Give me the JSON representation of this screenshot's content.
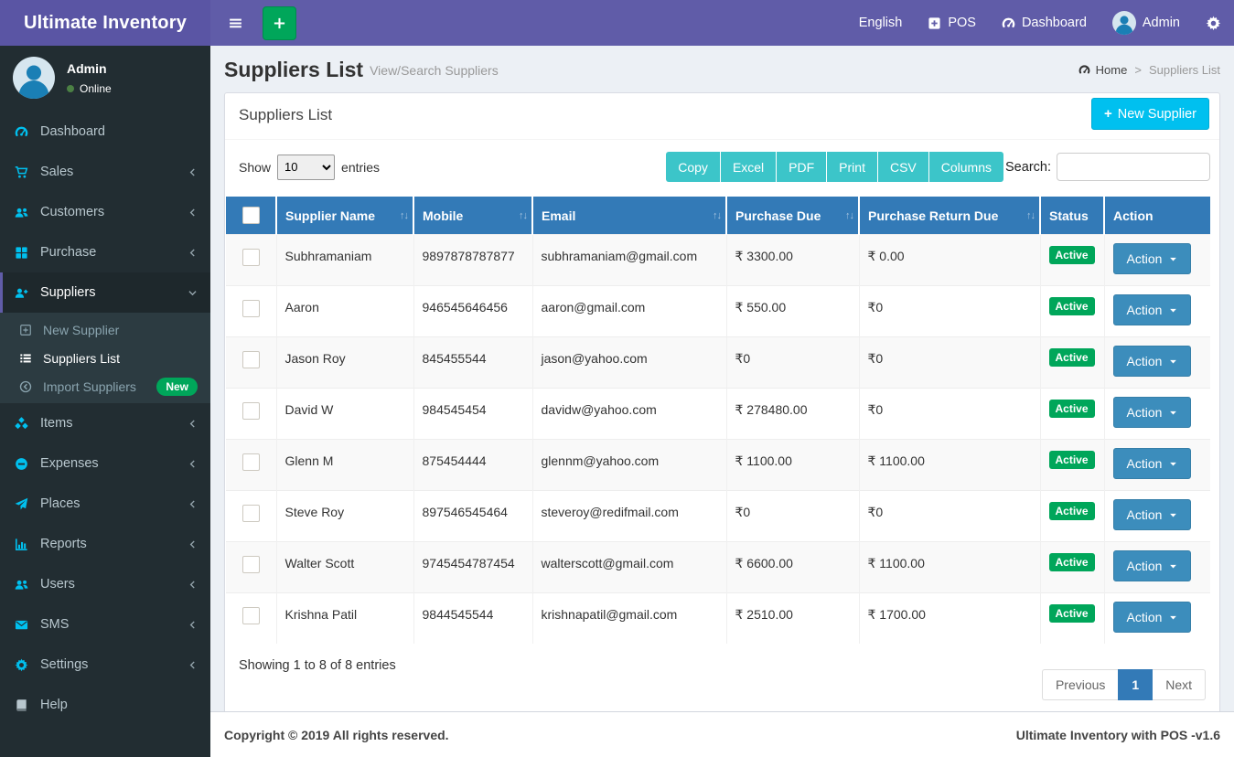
{
  "navbar": {
    "brand": "Ultimate Inventory",
    "language": "English",
    "pos": "POS",
    "dashboard": "Dashboard",
    "user": "Admin"
  },
  "sidebar": {
    "user": {
      "name": "Admin",
      "status": "Online"
    },
    "items": [
      {
        "label": "Dashboard",
        "icon": "tachometer-icon"
      },
      {
        "label": "Sales",
        "icon": "cart-icon",
        "chevron": "left"
      },
      {
        "label": "Customers",
        "icon": "users-icon",
        "chevron": "left"
      },
      {
        "label": "Purchase",
        "icon": "grid-icon",
        "chevron": "left"
      },
      {
        "label": "Suppliers",
        "icon": "user-plus-icon",
        "chevron": "down",
        "active": true,
        "submenu": [
          {
            "label": "New Supplier",
            "icon": "plus-square-outline-icon"
          },
          {
            "label": "Suppliers List",
            "icon": "list-icon",
            "active": true
          },
          {
            "label": "Import Suppliers",
            "icon": "arrow-circle-left-icon",
            "badge": "New"
          }
        ]
      },
      {
        "label": "Items",
        "icon": "cubes-icon",
        "chevron": "left"
      },
      {
        "label": "Expenses",
        "icon": "minus-circle-icon",
        "chevron": "left"
      },
      {
        "label": "Places",
        "icon": "paper-plane-icon",
        "chevron": "left"
      },
      {
        "label": "Reports",
        "icon": "bar-chart-icon",
        "chevron": "left"
      },
      {
        "label": "Users",
        "icon": "users-icon",
        "chevron": "left"
      },
      {
        "label": "SMS",
        "icon": "envelope-icon",
        "chevron": "left"
      },
      {
        "label": "Settings",
        "icon": "cogs-icon",
        "chevron": "left"
      },
      {
        "label": "Help",
        "icon": "book-icon"
      }
    ]
  },
  "page": {
    "title": "Suppliers List",
    "subtitle": "View/Search Suppliers",
    "breadcrumb": {
      "home": "Home",
      "current": "Suppliers List"
    }
  },
  "card": {
    "title": "Suppliers List",
    "new_button": "New Supplier",
    "show_label": "Show",
    "entries_label": "entries",
    "page_length": "10",
    "export_buttons": [
      "Copy",
      "Excel",
      "PDF",
      "Print",
      "CSV",
      "Columns"
    ],
    "search_label": "Search:",
    "search_value": "",
    "info": "Showing 1 to 8 of 8 entries",
    "pagination": {
      "previous": "Previous",
      "current": "1",
      "next": "Next"
    }
  },
  "table": {
    "columns": [
      "Supplier Name",
      "Mobile",
      "Email",
      "Purchase Due",
      "Purchase Return Due",
      "Status",
      "Action"
    ],
    "sortable": [
      true,
      true,
      true,
      true,
      true,
      false,
      false
    ],
    "action_label": "Action",
    "rows": [
      {
        "name": "Subhramaniam",
        "mobile": "9897878787877",
        "email": "subhramaniam@gmail.com",
        "purchase_due": "₹ 3300.00",
        "purchase_return_due": "₹ 0.00",
        "status": "Active"
      },
      {
        "name": "Aaron",
        "mobile": "946545646456",
        "email": "aaron@gmail.com",
        "purchase_due": "₹ 550.00",
        "purchase_return_due": "₹0",
        "status": "Active"
      },
      {
        "name": "Jason Roy",
        "mobile": "845455544",
        "email": "jason@yahoo.com",
        "purchase_due": "₹0",
        "purchase_return_due": "₹0",
        "status": "Active"
      },
      {
        "name": "David W",
        "mobile": "984545454",
        "email": "davidw@yahoo.com",
        "purchase_due": "₹ 278480.00",
        "purchase_return_due": "₹0",
        "status": "Active"
      },
      {
        "name": "Glenn M",
        "mobile": "875454444",
        "email": "glennm@yahoo.com",
        "purchase_due": "₹ 1100.00",
        "purchase_return_due": "₹ 1100.00",
        "status": "Active"
      },
      {
        "name": "Steve Roy",
        "mobile": "897546545464",
        "email": "steveroy@redifmail.com",
        "purchase_due": "₹0",
        "purchase_return_due": "₹0",
        "status": "Active"
      },
      {
        "name": "Walter Scott",
        "mobile": "9745454787454",
        "email": "walterscott@gmail.com",
        "purchase_due": "₹ 6600.00",
        "purchase_return_due": "₹ 1100.00",
        "status": "Active"
      },
      {
        "name": "Krishna Patil",
        "mobile": "9844545544",
        "email": "krishnapatil@gmail.com",
        "purchase_due": "₹ 2510.00",
        "purchase_return_due": "₹ 1700.00",
        "status": "Active"
      }
    ]
  },
  "footer": {
    "copyright": "Copyright © 2019 All rights reserved.",
    "version": "Ultimate Inventory with POS -v1.6"
  },
  "theme": {
    "navbar_purple": "#605ca8",
    "sidebar_dark": "#222d32",
    "submenu_dark": "#2c3b41",
    "icon_cyan": "#00c0ef",
    "table_header_blue": "#337ab7",
    "export_button_teal": "#3cc5c9",
    "new_supplier_blue": "#00c0ef",
    "action_blue": "#3c8dbc",
    "success_green": "#00a65a",
    "content_bg": "#ecf0f5"
  }
}
